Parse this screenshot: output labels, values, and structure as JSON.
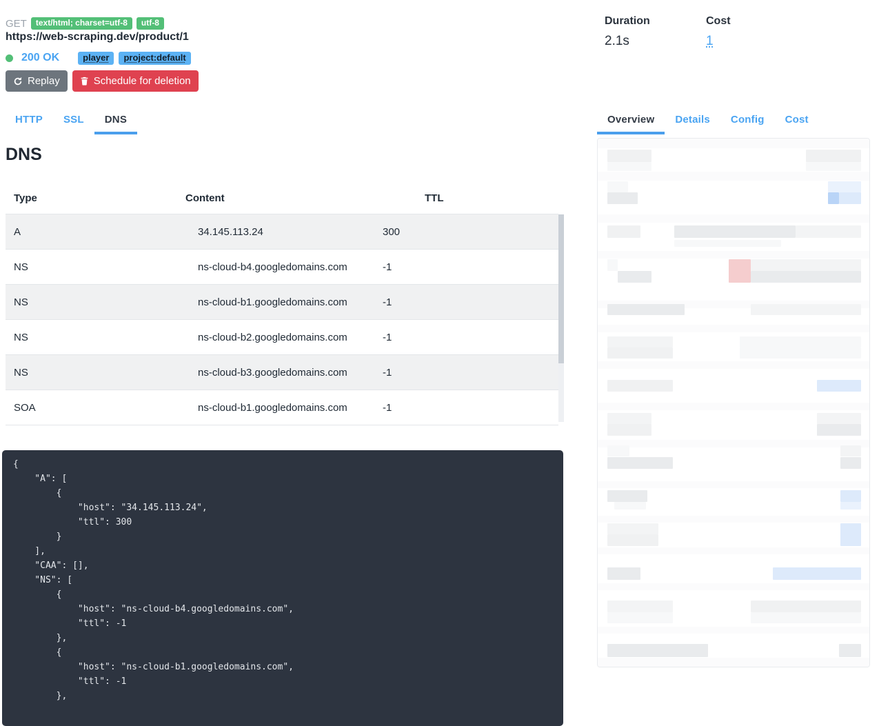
{
  "request": {
    "method": "GET",
    "content_type_badge": "text/html; charset=utf-8",
    "encoding_badge": "utf-8",
    "url": "https://web-scraping.dev/product/1",
    "status_code": "200 OK",
    "tags": [
      "player",
      "project:default"
    ],
    "replay_button": "Replay",
    "delete_button": "Schedule for deletion"
  },
  "request_tabs": [
    {
      "label": "HTTP",
      "active": false
    },
    {
      "label": "SSL",
      "active": false
    },
    {
      "label": "DNS",
      "active": true
    }
  ],
  "metrics": {
    "duration_label": "Duration",
    "duration_value": "2.1s",
    "cost_label": "Cost",
    "cost_value": "1"
  },
  "panel_tabs": [
    {
      "label": "Overview",
      "active": true
    },
    {
      "label": "Details",
      "active": false
    },
    {
      "label": "Config",
      "active": false
    },
    {
      "label": "Cost",
      "active": false
    }
  ],
  "dns": {
    "heading": "DNS",
    "table": {
      "columns": [
        "Type",
        "Content",
        "TTL"
      ],
      "rows": [
        [
          "A",
          "34.145.113.24",
          "300"
        ],
        [
          "NS",
          "ns-cloud-b4.googledomains.com",
          "-1"
        ],
        [
          "NS",
          "ns-cloud-b1.googledomains.com",
          "-1"
        ],
        [
          "NS",
          "ns-cloud-b2.googledomains.com",
          "-1"
        ],
        [
          "NS",
          "ns-cloud-b3.googledomains.com",
          "-1"
        ],
        [
          "SOA",
          "ns-cloud-b1.googledomains.com",
          "-1"
        ]
      ]
    },
    "raw_json_lines": [
      "{",
      "    \"A\": [",
      "        {",
      "            \"host\": \"34.145.113.24\",",
      "            \"ttl\": 300",
      "        }",
      "    ],",
      "    \"CAA\": [],",
      "    \"NS\": [",
      "        {",
      "            \"host\": \"ns-cloud-b4.googledomains.com\",",
      "            \"ttl\": -1",
      "        },",
      "        {",
      "            \"host\": \"ns-cloud-b1.googledomains.com\",",
      "            \"ttl\": -1",
      "        },"
    ]
  },
  "colors": {
    "accent_blue": "#4aa4f2",
    "tab_underline": "#4b9fec",
    "success_green": "#53bf77",
    "tag_blue": "#5cb2f4",
    "danger_red": "#df4250",
    "secondary_gray": "#6d757d",
    "code_background": "#2d3440"
  },
  "overview_panel": {
    "palette": {
      "st": "#fbfbfc",
      "g1": "#f0f1f2",
      "g2": "#f7f8f9",
      "g3": "#e9ebed",
      "g4": "#f3f4f5",
      "b1": "#ddeafb",
      "b2": "#b9d4f7",
      "b3": "#eaf2fd",
      "r1": "#f5cdce"
    },
    "blocks": [
      [
        0,
        0,
        396,
        14,
        "st"
      ],
      [
        0,
        48,
        396,
        13,
        "st"
      ],
      [
        0,
        110,
        396,
        12,
        "st"
      ],
      [
        0,
        163,
        396,
        11,
        "st"
      ],
      [
        0,
        235,
        396,
        11,
        "st"
      ],
      [
        0,
        270,
        396,
        11,
        "st"
      ],
      [
        0,
        323,
        396,
        11,
        "st"
      ],
      [
        0,
        383,
        396,
        11,
        "st"
      ],
      [
        0,
        437,
        396,
        11,
        "st"
      ],
      [
        0,
        497,
        396,
        10,
        "st"
      ],
      [
        0,
        547,
        396,
        10,
        "st"
      ],
      [
        0,
        593,
        396,
        10,
        "st"
      ],
      [
        0,
        645,
        396,
        10,
        "st"
      ],
      [
        0,
        708,
        396,
        10,
        "st"
      ],
      [
        0,
        753,
        396,
        13,
        "st"
      ],
      [
        14,
        16,
        64,
        18,
        "g1"
      ],
      [
        14,
        34,
        64,
        13,
        "g2"
      ],
      [
        302,
        16,
        80,
        18,
        "g1"
      ],
      [
        302,
        34,
        80,
        13,
        "g2"
      ],
      [
        14,
        62,
        30,
        16,
        "g2"
      ],
      [
        14,
        78,
        44,
        17,
        "g3"
      ],
      [
        334,
        62,
        48,
        16,
        "b3"
      ],
      [
        334,
        78,
        16,
        17,
        "b2"
      ],
      [
        350,
        78,
        32,
        17,
        "b1"
      ],
      [
        14,
        126,
        48,
        18,
        "g1"
      ],
      [
        111,
        126,
        176,
        18,
        "g3"
      ],
      [
        287,
        126,
        95,
        18,
        "g4"
      ],
      [
        111,
        147,
        155,
        10,
        "g2"
      ],
      [
        14,
        175,
        15,
        17,
        "g2"
      ],
      [
        29,
        192,
        49,
        17,
        "g3"
      ],
      [
        190,
        175,
        32,
        34,
        "r1"
      ],
      [
        222,
        175,
        160,
        17,
        "g4"
      ],
      [
        222,
        192,
        160,
        17,
        "g3"
      ],
      [
        14,
        240,
        112,
        16,
        "g3"
      ],
      [
        222,
        240,
        160,
        16,
        "g4"
      ],
      [
        14,
        287,
        95,
        16,
        "g4"
      ],
      [
        14,
        303,
        95,
        16,
        "g1"
      ],
      [
        206,
        287,
        176,
        16,
        "g2"
      ],
      [
        206,
        303,
        176,
        16,
        "g2"
      ],
      [
        14,
        350,
        95,
        17,
        "g1"
      ],
      [
        318,
        350,
        64,
        17,
        "b1"
      ],
      [
        14,
        398,
        64,
        16,
        "g4"
      ],
      [
        14,
        414,
        64,
        17,
        "g1"
      ],
      [
        318,
        398,
        64,
        16,
        "g4"
      ],
      [
        318,
        414,
        64,
        17,
        "g3"
      ],
      [
        14,
        445,
        32,
        16,
        "g2"
      ],
      [
        14,
        462,
        95,
        17,
        "g3"
      ],
      [
        352,
        445,
        30,
        16,
        "g4"
      ],
      [
        352,
        462,
        30,
        17,
        "g3"
      ],
      [
        14,
        510,
        58,
        17,
        "g3"
      ],
      [
        24,
        527,
        46,
        11,
        "g2"
      ],
      [
        352,
        510,
        30,
        17,
        "b1"
      ],
      [
        352,
        527,
        30,
        11,
        "b3"
      ],
      [
        14,
        558,
        74,
        16,
        "g4"
      ],
      [
        14,
        574,
        74,
        17,
        "g1"
      ],
      [
        352,
        558,
        30,
        33,
        "b1"
      ],
      [
        14,
        622,
        48,
        18,
        "g3"
      ],
      [
        254,
        622,
        128,
        18,
        "b1"
      ],
      [
        14,
        670,
        95,
        17,
        "g4"
      ],
      [
        14,
        687,
        95,
        16,
        "g2"
      ],
      [
        222,
        670,
        160,
        17,
        "g1"
      ],
      [
        222,
        687,
        160,
        16,
        "g2"
      ],
      [
        14,
        733,
        146,
        19,
        "g3"
      ],
      [
        350,
        733,
        32,
        19,
        "g3"
      ]
    ]
  }
}
